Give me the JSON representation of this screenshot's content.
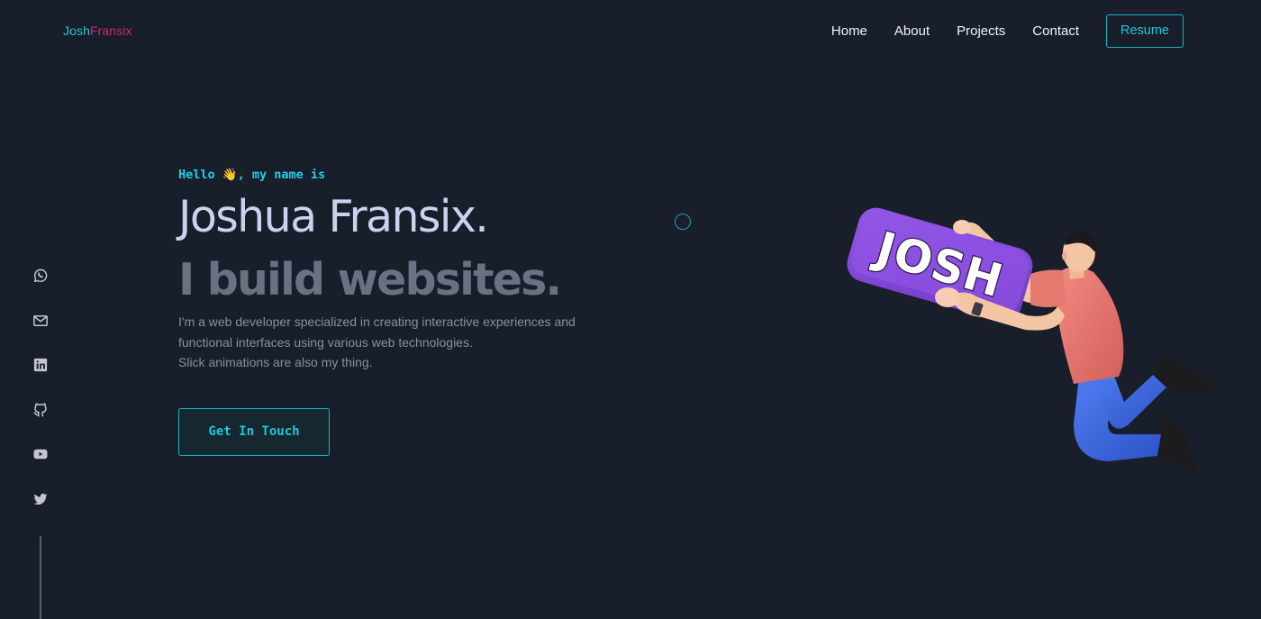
{
  "logo": {
    "part1": "Josh",
    "part2": "Fransix"
  },
  "nav": {
    "links": [
      "Home",
      "About",
      "Projects",
      "Contact"
    ],
    "resume_label": "Resume"
  },
  "hero": {
    "greeting_before": "Hello",
    "greeting_emoji": "👋",
    "greeting_after": ", my name is",
    "name": "Joshua Fransix.",
    "tagline": "I build websites.",
    "description_lines": [
      "I'm a web developer specialized in creating interactive experiences and",
      "functional interfaces using various web technologies.",
      "Slick animations are also my thing."
    ],
    "cta_label": "Get In Touch"
  },
  "illustration": {
    "sign_text": "JOSH"
  },
  "social": {
    "icons": [
      "whatsapp-icon",
      "email-icon",
      "linkedin-icon",
      "github-icon",
      "youtube-icon",
      "twitter-icon"
    ]
  },
  "colors": {
    "background": "#181e2a",
    "accent_cyan": "#1fc6da",
    "accent_pink": "#d1267a",
    "name_text": "#ccd1ed",
    "tagline_text": "#6b7183",
    "sign_purple": "#8448d8"
  }
}
